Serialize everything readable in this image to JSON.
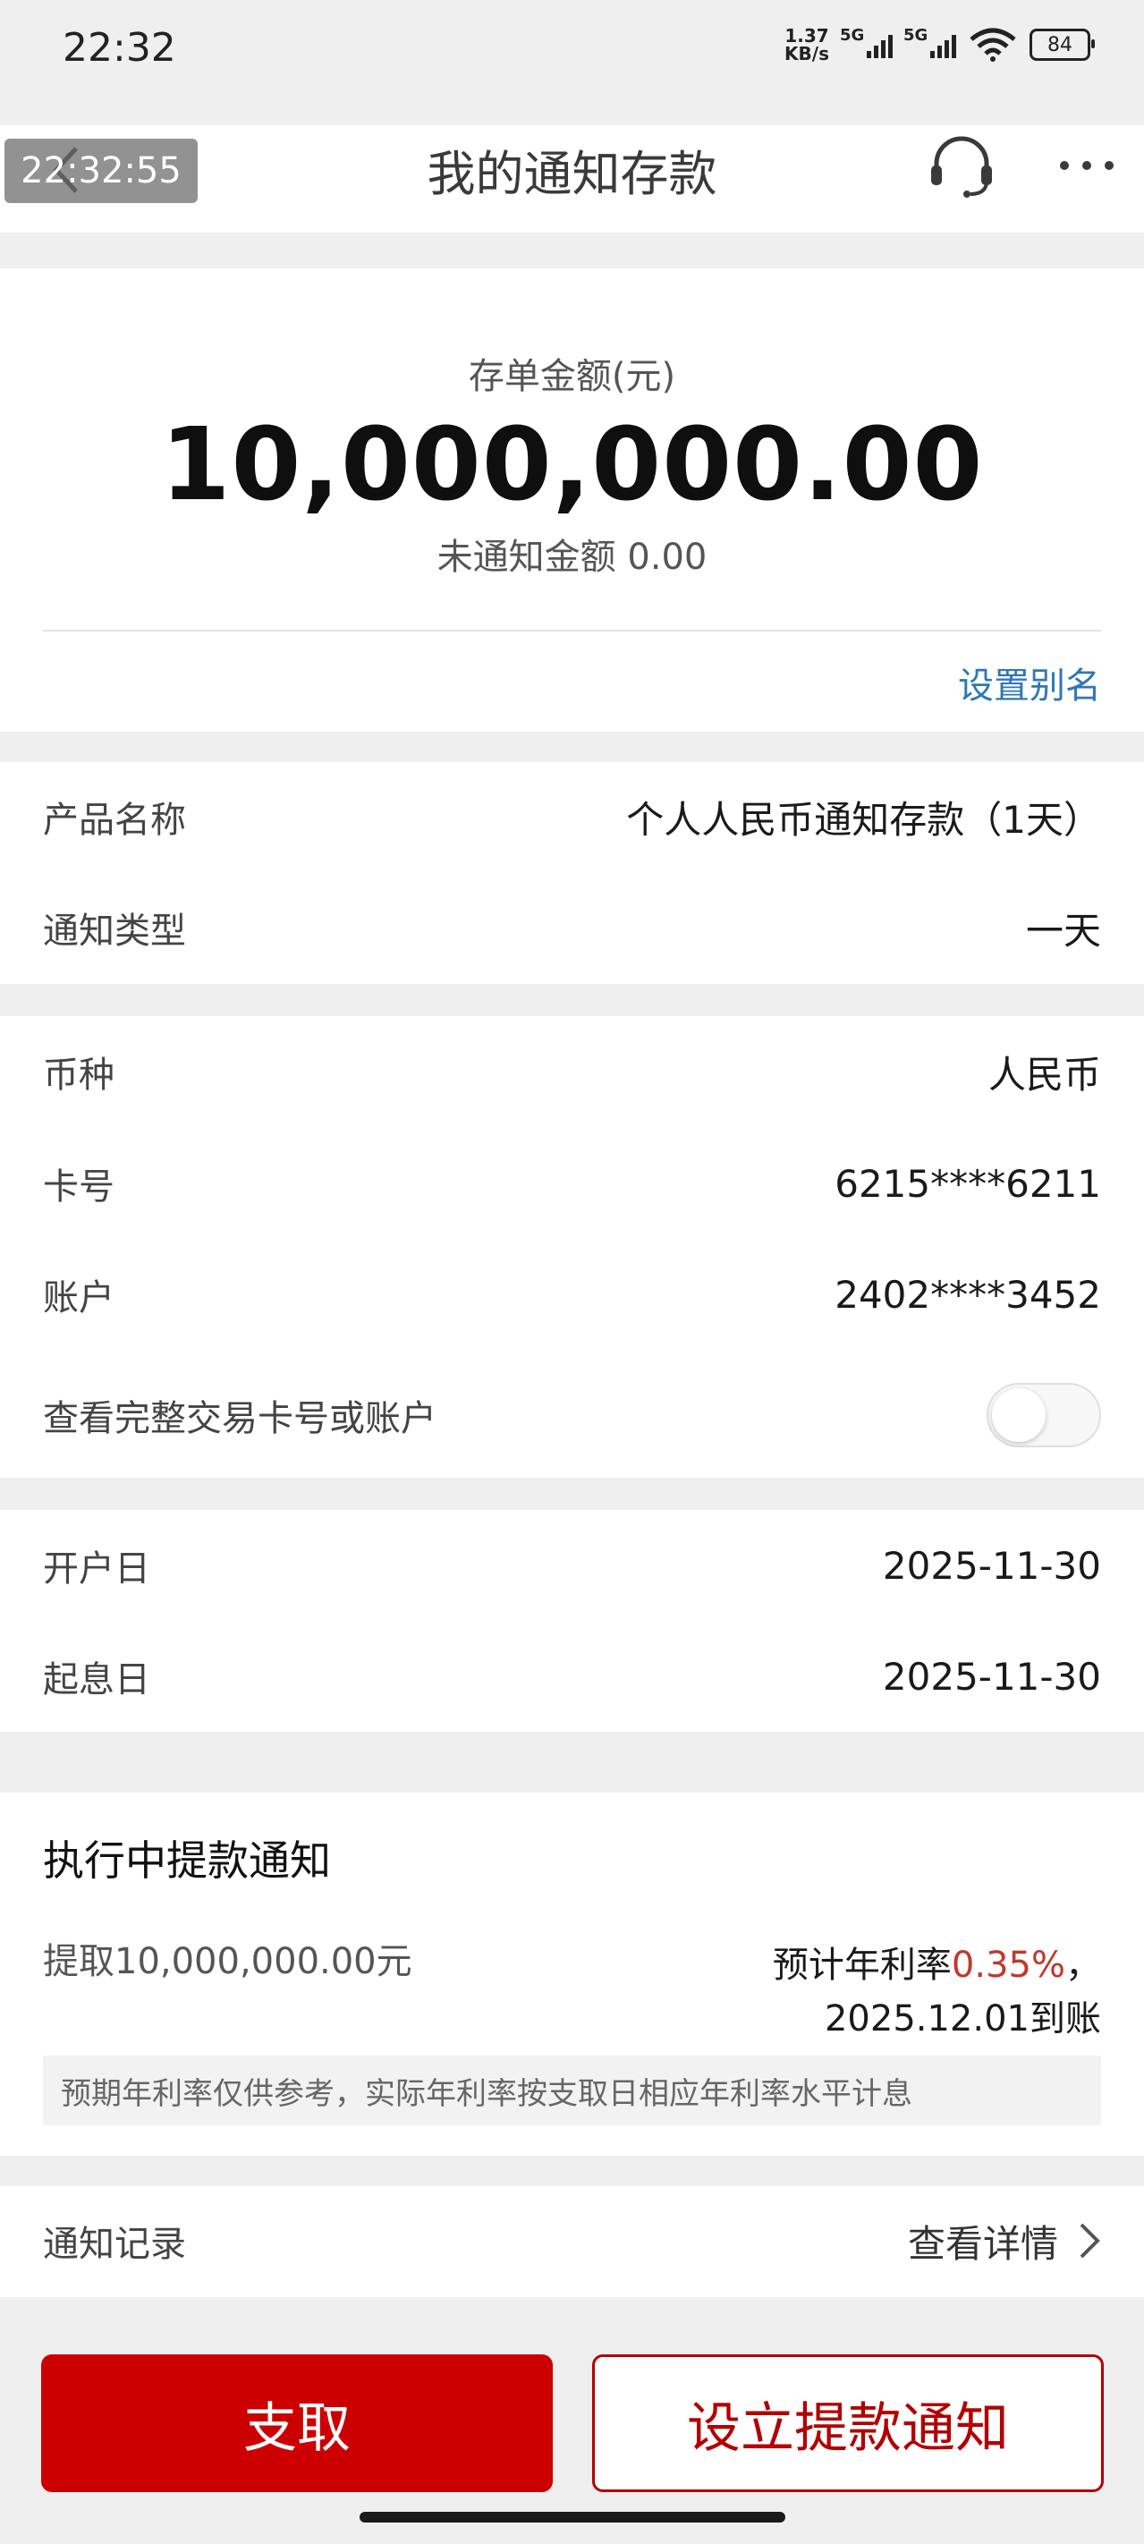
{
  "status_bar": {
    "time": "22:32",
    "net_speed_value": "1.37",
    "net_speed_unit": "KB/s",
    "sim1": "5G",
    "sim2": "5G",
    "battery": "84"
  },
  "header": {
    "timestamp_overlay": "22:32:55",
    "title": "我的通知存款"
  },
  "summary": {
    "amount_label": "存单金额(元)",
    "amount": "10,000,000.00",
    "unnotified_label": "未通知金额 0.00",
    "alias_link": "设置别名"
  },
  "product": {
    "rows": [
      {
        "label": "产品名称",
        "value": "个人人民币通知存款（1天）"
      },
      {
        "label": "通知类型",
        "value": "一天"
      }
    ]
  },
  "account": {
    "rows": [
      {
        "label": "币种",
        "value": "人民币"
      },
      {
        "label": "卡号",
        "value": "6215****6211"
      },
      {
        "label": "账户",
        "value": "2402****3452"
      }
    ],
    "toggle_label": "查看完整交易卡号或账户",
    "toggle_on": false
  },
  "dates": {
    "rows": [
      {
        "label": "开户日",
        "value": "2025-11-30"
      },
      {
        "label": "起息日",
        "value": "2025-11-30"
      }
    ]
  },
  "withdrawal_notice": {
    "title": "执行中提款通知",
    "withdraw_text": "提取10,000,000.00元",
    "rate_prefix": "预计年利率",
    "rate": "0.35%",
    "rate_suffix": "，",
    "arrival": "2025.12.01到账",
    "note": "预期年利率仅供参考，实际年利率按支取日相应年利率水平计息"
  },
  "records": {
    "label": "通知记录",
    "link": "查看详情"
  },
  "actions": {
    "withdraw_button": "支取",
    "notice_button": "设立提款通知"
  },
  "colors": {
    "accent_red": "#cc0000",
    "link_blue": "#2f77b6",
    "rate_red": "#c0392b"
  }
}
